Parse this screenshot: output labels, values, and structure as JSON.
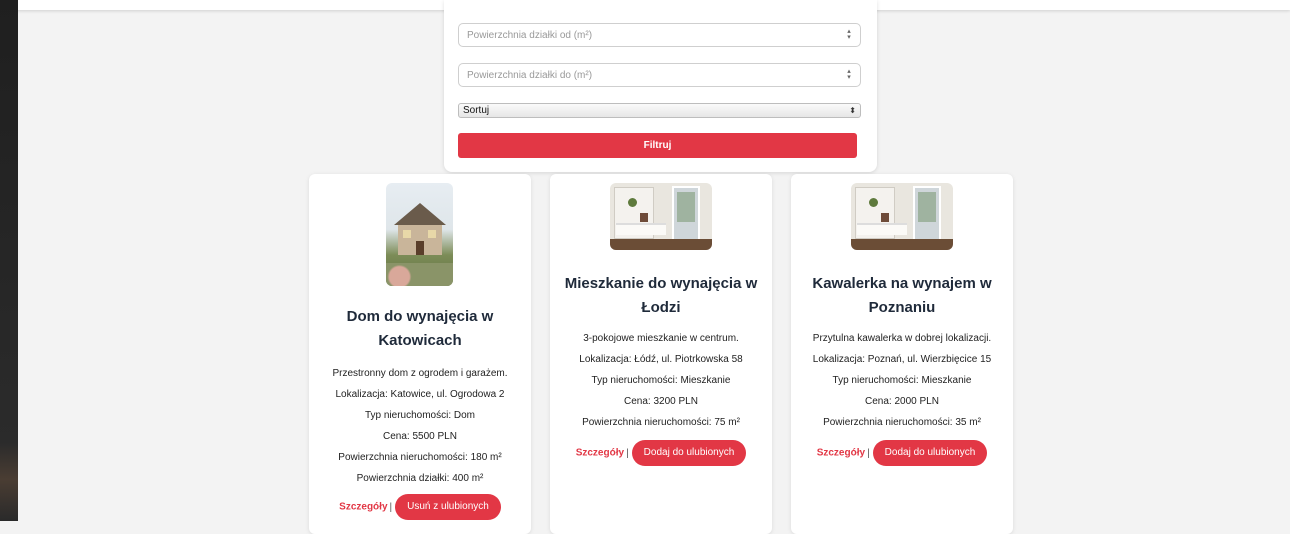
{
  "filters": {
    "area_from_placeholder": "Powierzchnia działki od (m²)",
    "area_to_placeholder": "Powierzchnia działki do (m²)",
    "sort_label": "Sortuj",
    "filter_button": "Filtruj"
  },
  "colors": {
    "accent": "#e23745",
    "title": "#1f2a3a",
    "page_bg": "#f3f3f3"
  },
  "listings": [
    {
      "title": "Dom do wynajęcia w Katowicach",
      "description": "Przestronny dom z ogrodem i garażem.",
      "location": "Lokalizacja: Katowice, ul. Ogrodowa 2",
      "type": "Typ nieruchomości: Dom",
      "price": "Cena: 5500 PLN",
      "area": "Powierzchnia nieruchomości: 180 m²",
      "plot_area": "Powierzchnia działki: 400 m²",
      "details_link": "Szczegóły",
      "separator": "|",
      "favorite_button": "Usuń z ulubionych"
    },
    {
      "title": "Mieszkanie do wynajęcia w Łodzi",
      "description": "3-pokojowe mieszkanie w centrum.",
      "location": "Lokalizacja: Łódź, ul. Piotrkowska 58",
      "type": "Typ nieruchomości: Mieszkanie",
      "price": "Cena: 3200 PLN",
      "area": "Powierzchnia nieruchomości: 75 m²",
      "details_link": "Szczegóły",
      "separator": "|",
      "favorite_button": "Dodaj do ulubionych"
    },
    {
      "title": "Kawalerka na wynajem w Poznaniu",
      "description": "Przytulna kawalerka w dobrej lokalizacji.",
      "location": "Lokalizacja: Poznań, ul. Wierzbięcice 15",
      "type": "Typ nieruchomości: Mieszkanie",
      "price": "Cena: 2000 PLN",
      "area": "Powierzchnia nieruchomości: 35 m²",
      "details_link": "Szczegóły",
      "separator": "|",
      "favorite_button": "Dodaj do ulubionych"
    }
  ]
}
